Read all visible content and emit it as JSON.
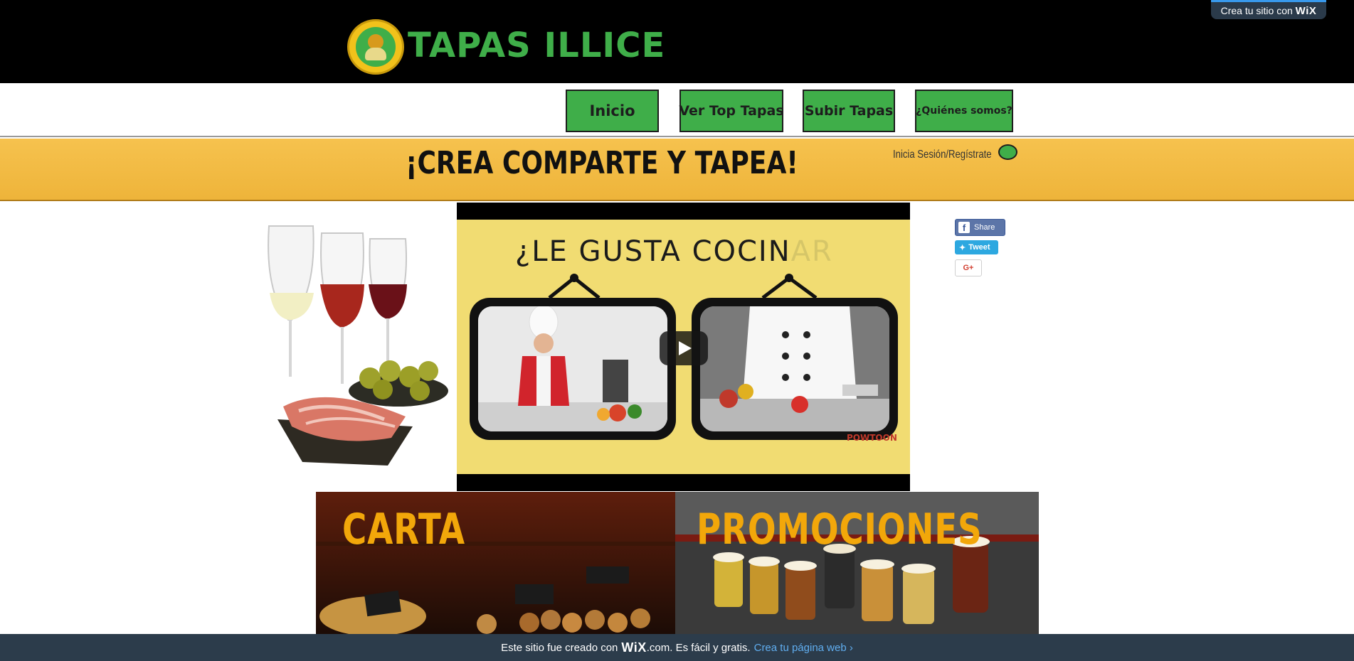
{
  "header": {
    "brand": "TAPAS ILLICE",
    "wix_badge_prefix": "Crea tu sitio con",
    "wix_badge_brand": "WiX"
  },
  "nav": {
    "items": [
      {
        "label": "Inicio"
      },
      {
        "label": "Ver Top Tapas"
      },
      {
        "label": "Subir Tapas"
      },
      {
        "label": "¿Quiénes somos?"
      }
    ]
  },
  "banner": {
    "slogan": "¡CREA COMPARTE Y TAPEA!",
    "login": "Inicia Sesión/Regístrate"
  },
  "video": {
    "title": "¿LE GUSTA COCIN",
    "title_suffix": "AR",
    "credit": "POWTOON"
  },
  "social": {
    "share": "Share",
    "tweet": "Tweet",
    "gplus": "G+"
  },
  "cards": [
    {
      "label": "CARTA"
    },
    {
      "label": "PROMOCIONES"
    }
  ],
  "footer": {
    "text_before": "Este sitio fue creado con",
    "brand": "WiX",
    "text_after": ".com. Es fácil y gratis.",
    "cta": "Crea tu página web ›"
  },
  "colors": {
    "brand_green": "#3fae49",
    "banner_yellow": "#f2bb45",
    "card_text_orange": "#f2a70a",
    "footer_bg": "#2c3c4b",
    "footer_link": "#60aef0"
  },
  "icons": [
    "logo-icon",
    "play-icon",
    "facebook-icon",
    "twitter-icon",
    "google-plus-icon"
  ]
}
